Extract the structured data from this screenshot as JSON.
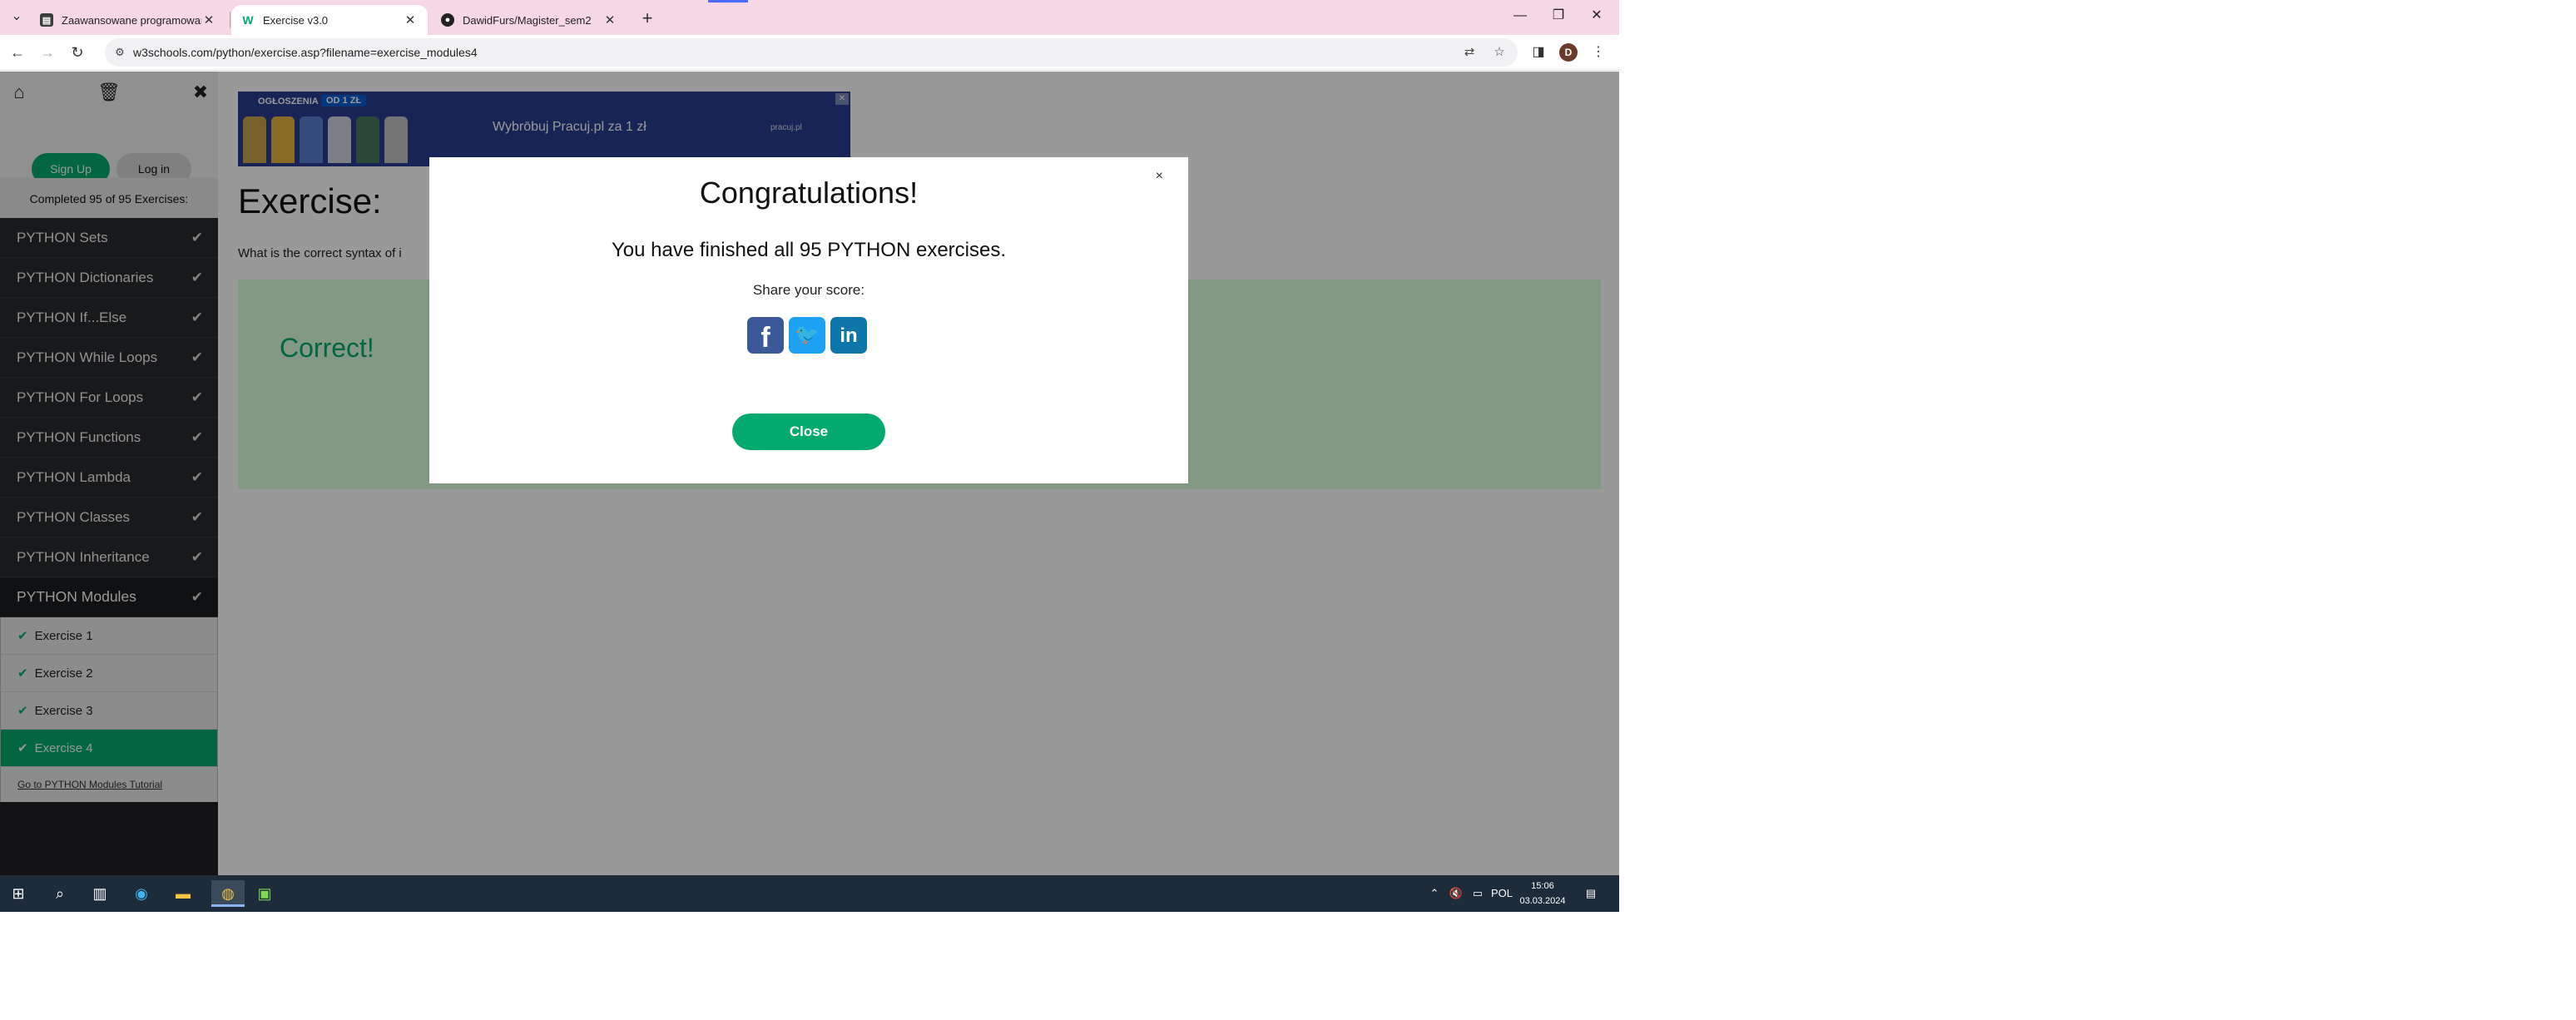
{
  "browser": {
    "tabs": [
      {
        "title": "Zaawansowane programowanie",
        "favicon": "document-icon",
        "active": false
      },
      {
        "title": "Exercise v3.0",
        "favicon": "w3schools-icon",
        "active": true
      },
      {
        "title": "DawidFurs/Magister_sem2",
        "favicon": "github-icon",
        "active": false
      }
    ],
    "url": "w3schools.com/python/exercise.asp?filename=exercise_modules4",
    "profile_initial": "D"
  },
  "sidebar": {
    "signup_label": "Sign Up",
    "login_label": "Log in",
    "progress_text": "Completed 95 of 95 Exercises:",
    "topics": [
      {
        "label": "PYTHON Sets"
      },
      {
        "label": "PYTHON Dictionaries"
      },
      {
        "label": "PYTHON If...Else"
      },
      {
        "label": "PYTHON While Loops"
      },
      {
        "label": "PYTHON For Loops"
      },
      {
        "label": "PYTHON Functions"
      },
      {
        "label": "PYTHON Lambda"
      },
      {
        "label": "PYTHON Classes"
      },
      {
        "label": "PYTHON Inheritance"
      },
      {
        "label": "PYTHON Modules"
      }
    ],
    "exercises": [
      {
        "label": "Exercise 1"
      },
      {
        "label": "Exercise 2"
      },
      {
        "label": "Exercise 3"
      },
      {
        "label": "Exercise 4"
      }
    ],
    "tutorial_link": "Go to PYTHON Modules Tutorial"
  },
  "ad": {
    "tag": "OGŁOSZENIA",
    "price": "OD 1 ZŁ",
    "text": "Wybrōbuj Pracuj.pl za 1 zł",
    "logo": "pracuj.pl"
  },
  "main": {
    "title": "Exercise:",
    "question": "What is the correct syntax of i",
    "result": "Correct!"
  },
  "modal": {
    "title": "Congratulations!",
    "message": "You have finished all 95 PYTHON exercises.",
    "share_label": "Share your score:",
    "close_label": "Close",
    "close_x": "×"
  },
  "taskbar": {
    "lang": "POL",
    "time": "15:06",
    "date": "03.03.2024"
  },
  "colors": {
    "accent": "#04aa6d",
    "tab_strip": "#f6d7e6",
    "sidebar": "#282a2d",
    "taskbar": "#1d2b3a"
  }
}
